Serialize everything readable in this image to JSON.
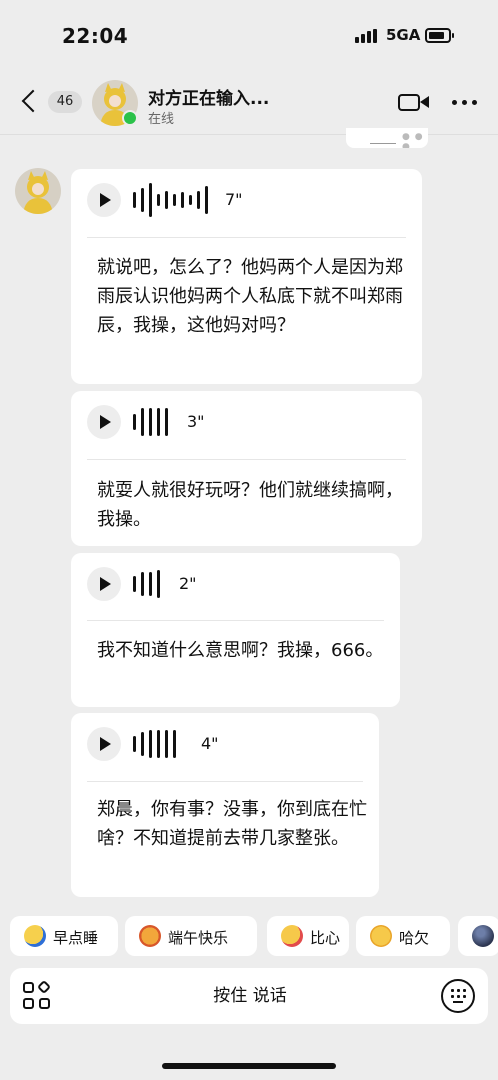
{
  "status_bar": {
    "time": "22:04",
    "network": "5GA"
  },
  "header": {
    "unread_count": "46",
    "title": "对方正在输入...",
    "status": "在线"
  },
  "messages": [
    {
      "type": "voice",
      "duration": "7\"",
      "transcript": "就说吧，怎么了？他妈两个人是因为郑雨辰认识他妈两个人私底下就不叫郑雨辰，我操，这他妈对吗？"
    },
    {
      "type": "voice",
      "duration": "3\"",
      "transcript": "就耍人就很好玩呀？他们就继续搞啊，我操。"
    },
    {
      "type": "voice",
      "duration": "2\"",
      "transcript": "我不知道什么意思啊？我操，666。"
    },
    {
      "type": "voice",
      "duration": "4\"",
      "transcript": "郑晨，你有事？没事，你到底在忙啥？不知道提前去带几家整张。"
    }
  ],
  "sticker_suggestions": [
    {
      "label": "早点睡",
      "icon": "sleep-emoji-icon"
    },
    {
      "label": "端午快乐",
      "icon": "dragon-emoji-icon"
    },
    {
      "label": "比心",
      "icon": "heart-hands-emoji-icon"
    },
    {
      "label": "哈欠",
      "icon": "yawn-emoji-icon"
    },
    {
      "label": "",
      "icon": "dark-face-emoji-icon"
    }
  ],
  "input_bar": {
    "hold_to_talk_label": "按住 说话"
  },
  "colors": {
    "online": "#2bc24a",
    "background": "#ededed",
    "bubble": "#ffffff"
  }
}
